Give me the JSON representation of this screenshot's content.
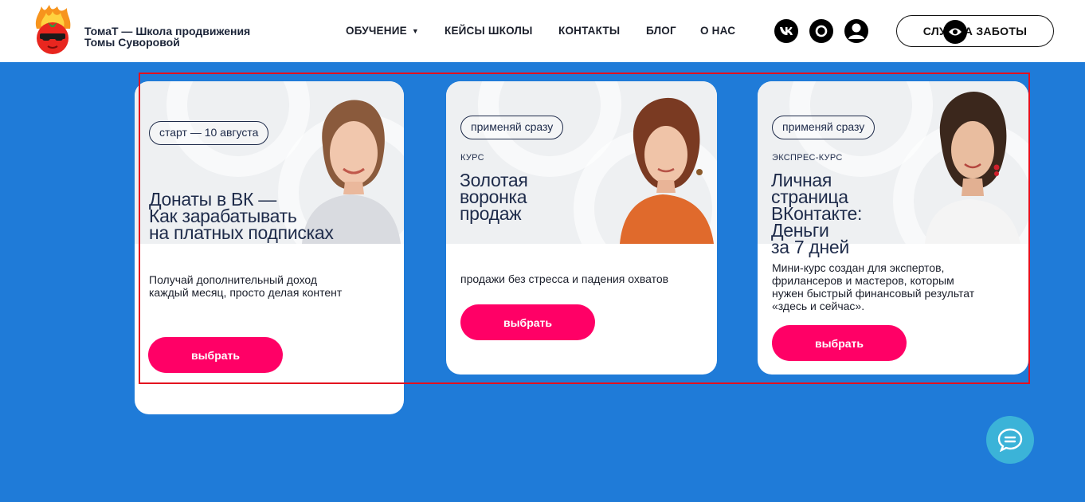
{
  "header": {
    "brand_line1": "ТомаТ — Школа продвижения",
    "brand_line2": "Томы Суворовой",
    "nav": [
      "ОБУЧЕНИЕ",
      "КЕЙСЫ ШКОЛЫ",
      "КОНТАКТЫ",
      "БЛОГ",
      "О НАС"
    ],
    "care_button": "СЛУЖБА ЗАБОТЫ",
    "social_icons": [
      "vk-icon",
      "max-messenger-icon",
      "user-icon"
    ]
  },
  "cards": [
    {
      "tag": "старт — 10 августа",
      "kind": "",
      "title_lines": [
        "Донаты в ВК —",
        "Как зарабатывать",
        "на платных подписках"
      ],
      "desc_lines": [
        "Получай дополнительный доход",
        "каждый месяц, просто делая контент"
      ],
      "button": "выбрать"
    },
    {
      "tag": "применяй сразу",
      "kind": "КУРС",
      "title_lines": [
        "Золотая",
        "воронка",
        "продаж"
      ],
      "desc_lines": [
        "продажи без стресса и падения охватов"
      ],
      "button": "выбрать"
    },
    {
      "tag": "применяй сразу",
      "kind": "ЭКСПРЕС-КУРС",
      "title_lines": [
        "Личная",
        "страница",
        "ВКонтакте:",
        "Деньги",
        "за 7 дней"
      ],
      "desc_lines": [
        "Мини-курс создан для экспертов,",
        "фрилансеров и мастеров, которым",
        "нужен быстрый финансовый результат",
        "«здесь и сейчас»."
      ],
      "button": "выбрать"
    }
  ],
  "colors": {
    "background": "#1f7bd8",
    "accent": "#ff0066",
    "title": "#1e2b4a",
    "chat": "#3bb3d8"
  }
}
